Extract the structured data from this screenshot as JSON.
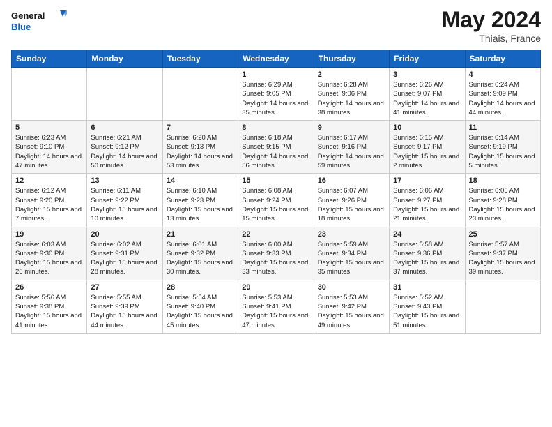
{
  "logo": {
    "general": "General",
    "blue": "Blue"
  },
  "header": {
    "month": "May 2024",
    "location": "Thiais, France"
  },
  "days_of_week": [
    "Sunday",
    "Monday",
    "Tuesday",
    "Wednesday",
    "Thursday",
    "Friday",
    "Saturday"
  ],
  "weeks": [
    [
      {
        "day": "",
        "info": ""
      },
      {
        "day": "",
        "info": ""
      },
      {
        "day": "",
        "info": ""
      },
      {
        "day": "1",
        "info": "Sunrise: 6:29 AM\nSunset: 9:05 PM\nDaylight: 14 hours and 35 minutes."
      },
      {
        "day": "2",
        "info": "Sunrise: 6:28 AM\nSunset: 9:06 PM\nDaylight: 14 hours and 38 minutes."
      },
      {
        "day": "3",
        "info": "Sunrise: 6:26 AM\nSunset: 9:07 PM\nDaylight: 14 hours and 41 minutes."
      },
      {
        "day": "4",
        "info": "Sunrise: 6:24 AM\nSunset: 9:09 PM\nDaylight: 14 hours and 44 minutes."
      }
    ],
    [
      {
        "day": "5",
        "info": "Sunrise: 6:23 AM\nSunset: 9:10 PM\nDaylight: 14 hours and 47 minutes."
      },
      {
        "day": "6",
        "info": "Sunrise: 6:21 AM\nSunset: 9:12 PM\nDaylight: 14 hours and 50 minutes."
      },
      {
        "day": "7",
        "info": "Sunrise: 6:20 AM\nSunset: 9:13 PM\nDaylight: 14 hours and 53 minutes."
      },
      {
        "day": "8",
        "info": "Sunrise: 6:18 AM\nSunset: 9:15 PM\nDaylight: 14 hours and 56 minutes."
      },
      {
        "day": "9",
        "info": "Sunrise: 6:17 AM\nSunset: 9:16 PM\nDaylight: 14 hours and 59 minutes."
      },
      {
        "day": "10",
        "info": "Sunrise: 6:15 AM\nSunset: 9:17 PM\nDaylight: 15 hours and 2 minutes."
      },
      {
        "day": "11",
        "info": "Sunrise: 6:14 AM\nSunset: 9:19 PM\nDaylight: 15 hours and 5 minutes."
      }
    ],
    [
      {
        "day": "12",
        "info": "Sunrise: 6:12 AM\nSunset: 9:20 PM\nDaylight: 15 hours and 7 minutes."
      },
      {
        "day": "13",
        "info": "Sunrise: 6:11 AM\nSunset: 9:22 PM\nDaylight: 15 hours and 10 minutes."
      },
      {
        "day": "14",
        "info": "Sunrise: 6:10 AM\nSunset: 9:23 PM\nDaylight: 15 hours and 13 minutes."
      },
      {
        "day": "15",
        "info": "Sunrise: 6:08 AM\nSunset: 9:24 PM\nDaylight: 15 hours and 15 minutes."
      },
      {
        "day": "16",
        "info": "Sunrise: 6:07 AM\nSunset: 9:26 PM\nDaylight: 15 hours and 18 minutes."
      },
      {
        "day": "17",
        "info": "Sunrise: 6:06 AM\nSunset: 9:27 PM\nDaylight: 15 hours and 21 minutes."
      },
      {
        "day": "18",
        "info": "Sunrise: 6:05 AM\nSunset: 9:28 PM\nDaylight: 15 hours and 23 minutes."
      }
    ],
    [
      {
        "day": "19",
        "info": "Sunrise: 6:03 AM\nSunset: 9:30 PM\nDaylight: 15 hours and 26 minutes."
      },
      {
        "day": "20",
        "info": "Sunrise: 6:02 AM\nSunset: 9:31 PM\nDaylight: 15 hours and 28 minutes."
      },
      {
        "day": "21",
        "info": "Sunrise: 6:01 AM\nSunset: 9:32 PM\nDaylight: 15 hours and 30 minutes."
      },
      {
        "day": "22",
        "info": "Sunrise: 6:00 AM\nSunset: 9:33 PM\nDaylight: 15 hours and 33 minutes."
      },
      {
        "day": "23",
        "info": "Sunrise: 5:59 AM\nSunset: 9:34 PM\nDaylight: 15 hours and 35 minutes."
      },
      {
        "day": "24",
        "info": "Sunrise: 5:58 AM\nSunset: 9:36 PM\nDaylight: 15 hours and 37 minutes."
      },
      {
        "day": "25",
        "info": "Sunrise: 5:57 AM\nSunset: 9:37 PM\nDaylight: 15 hours and 39 minutes."
      }
    ],
    [
      {
        "day": "26",
        "info": "Sunrise: 5:56 AM\nSunset: 9:38 PM\nDaylight: 15 hours and 41 minutes."
      },
      {
        "day": "27",
        "info": "Sunrise: 5:55 AM\nSunset: 9:39 PM\nDaylight: 15 hours and 44 minutes."
      },
      {
        "day": "28",
        "info": "Sunrise: 5:54 AM\nSunset: 9:40 PM\nDaylight: 15 hours and 45 minutes."
      },
      {
        "day": "29",
        "info": "Sunrise: 5:53 AM\nSunset: 9:41 PM\nDaylight: 15 hours and 47 minutes."
      },
      {
        "day": "30",
        "info": "Sunrise: 5:53 AM\nSunset: 9:42 PM\nDaylight: 15 hours and 49 minutes."
      },
      {
        "day": "31",
        "info": "Sunrise: 5:52 AM\nSunset: 9:43 PM\nDaylight: 15 hours and 51 minutes."
      },
      {
        "day": "",
        "info": ""
      }
    ]
  ]
}
